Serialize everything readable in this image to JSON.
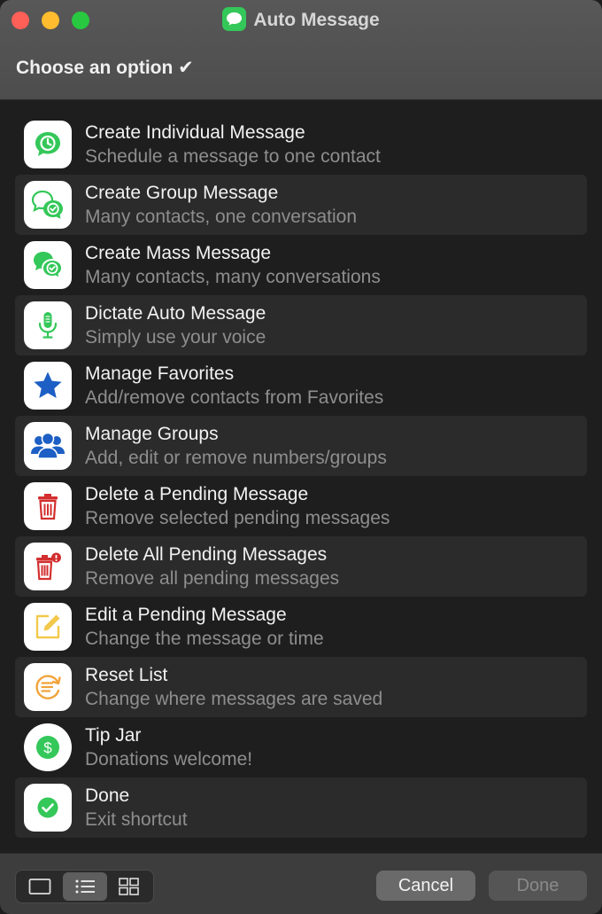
{
  "window": {
    "title": "Auto Message",
    "prompt": "Choose an option ✔"
  },
  "options": [
    {
      "title": "Create Individual Message",
      "subtitle": "Schedule a message to one contact",
      "icon": "clock-bubble-icon"
    },
    {
      "title": "Create Group Message",
      "subtitle": "Many contacts, one conversation",
      "icon": "group-bubble-icon"
    },
    {
      "title": "Create Mass Message",
      "subtitle": "Many contacts, many conversations",
      "icon": "mass-bubble-icon"
    },
    {
      "title": "Dictate Auto Message",
      "subtitle": "Simply use your voice",
      "icon": "microphone-icon"
    },
    {
      "title": "Manage Favorites",
      "subtitle": "Add/remove contacts from Favorites",
      "icon": "star-icon"
    },
    {
      "title": "Manage Groups",
      "subtitle": "Add, edit or remove numbers/groups",
      "icon": "people-icon"
    },
    {
      "title": "Delete a Pending Message",
      "subtitle": "Remove selected pending messages",
      "icon": "trash-icon"
    },
    {
      "title": "Delete All Pending Messages",
      "subtitle": "Remove all pending messages",
      "icon": "trash-all-icon"
    },
    {
      "title": "Edit a Pending Message",
      "subtitle": "Change the message or time",
      "icon": "edit-icon"
    },
    {
      "title": "Reset List",
      "subtitle": "Change where messages are saved",
      "icon": "reset-list-icon"
    },
    {
      "title": "Tip Jar",
      "subtitle": "Donations welcome!",
      "icon": "dollar-icon"
    },
    {
      "title": "Done",
      "subtitle": "Exit shortcut",
      "icon": "checkmark-icon"
    }
  ],
  "footer": {
    "cancel_label": "Cancel",
    "done_label": "Done",
    "view_modes": [
      "single-view-icon",
      "list-view-icon",
      "grid-view-icon"
    ]
  },
  "colors": {
    "green": "#34c759",
    "blue": "#1d5fc4",
    "red": "#d32f2f",
    "yellow": "#f2c94c",
    "orange": "#f2a33a"
  }
}
